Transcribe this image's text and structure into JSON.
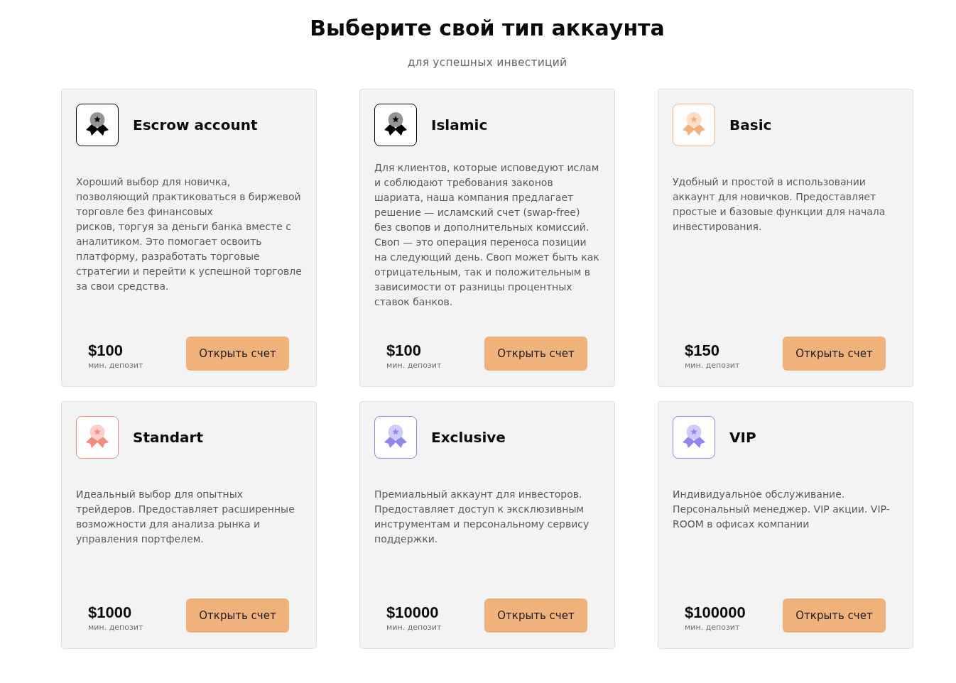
{
  "page": {
    "title": "Выберите свой тип аккаунта",
    "subtitle": "для успешных инвестиций"
  },
  "accounts": [
    {
      "name": "Escrow account",
      "color": "#000000",
      "description": "Хороший выбор для новичка, позволяющий практиковаться в биржевой торговле без финансовых\nрисков, торгуя за деньги банка вместе с аналитиком. Это помогает освоить платформу, разработать торговые стратегии и перейти к успешной торговле за свои средства.",
      "price": "$100",
      "price_caption": "мин. депозит",
      "button": "Открыть счет"
    },
    {
      "name": "Islamic",
      "color": "#000000",
      "description": "Для клиентов, которые исповедуют ислам и соблюдают требования законов шариата, наша компания предлагает решение — исламский счет (swap-free) без свопов и дополнительных комиссий. Своп — это операция переноса позиции на следующий день. Своп может быть как отрицательным, так и положительным в зависимости от разницы процентных ставок банков.",
      "price": "$100",
      "price_caption": "мин. депозит",
      "button": "Открыть счет"
    },
    {
      "name": "Basic",
      "color": "#f2b07c",
      "description": "Удобный и простой в использовании аккаунт для новичков. Предоставляет простые и базовые функции для начала инвестирования.",
      "price": "$150",
      "price_caption": "мин. депозит",
      "button": "Открыть счет"
    },
    {
      "name": "Standart",
      "color": "#f28b82",
      "description": "Идеальный выбор для опытных трейдеров. Предоставляет расширенные возможности для анализа рынка и управления портфелем.",
      "price": "$1000",
      "price_caption": "мин. депозит",
      "button": "Открыть счет"
    },
    {
      "name": "Exclusive",
      "color": "#8f86f0",
      "description": "Премиальный аккаунт для инвесторов. Предоставляет доступ к эксклюзивным инструментам и персональному сервису поддержки.",
      "price": "$10000",
      "price_caption": "мин. депозит",
      "button": "Открыть счет"
    },
    {
      "name": "VIP",
      "color": "#8f86f0",
      "description": "Индивидуальное обслуживание. Персональный менеджер. VIP акции. VIP-ROOM в офисах компании",
      "price": "$100000",
      "price_caption": "мин. депозит",
      "button": "Открыть счет"
    }
  ]
}
